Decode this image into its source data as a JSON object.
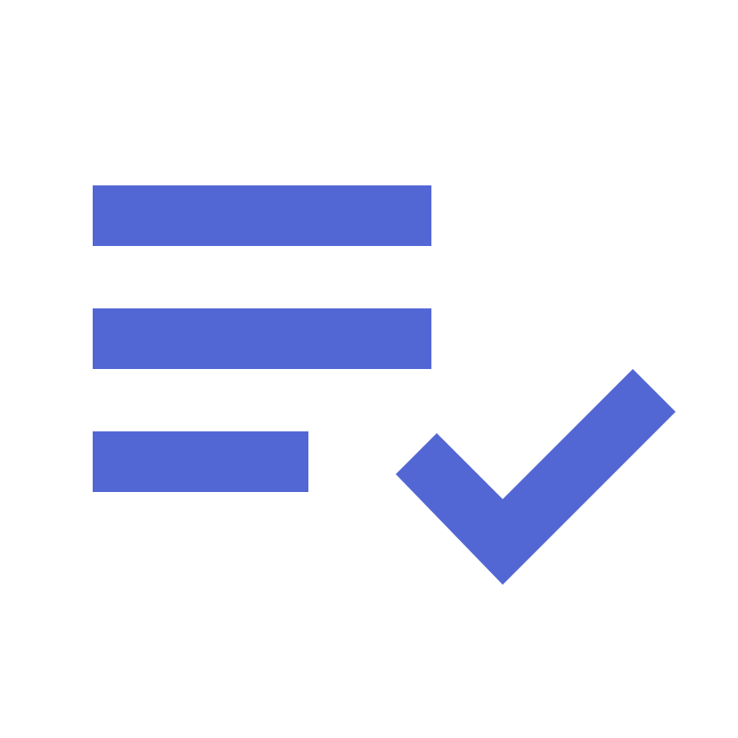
{
  "icon": {
    "name": "playlist-add-check-icon",
    "color": "#5367d4",
    "background": "#ffffff"
  }
}
